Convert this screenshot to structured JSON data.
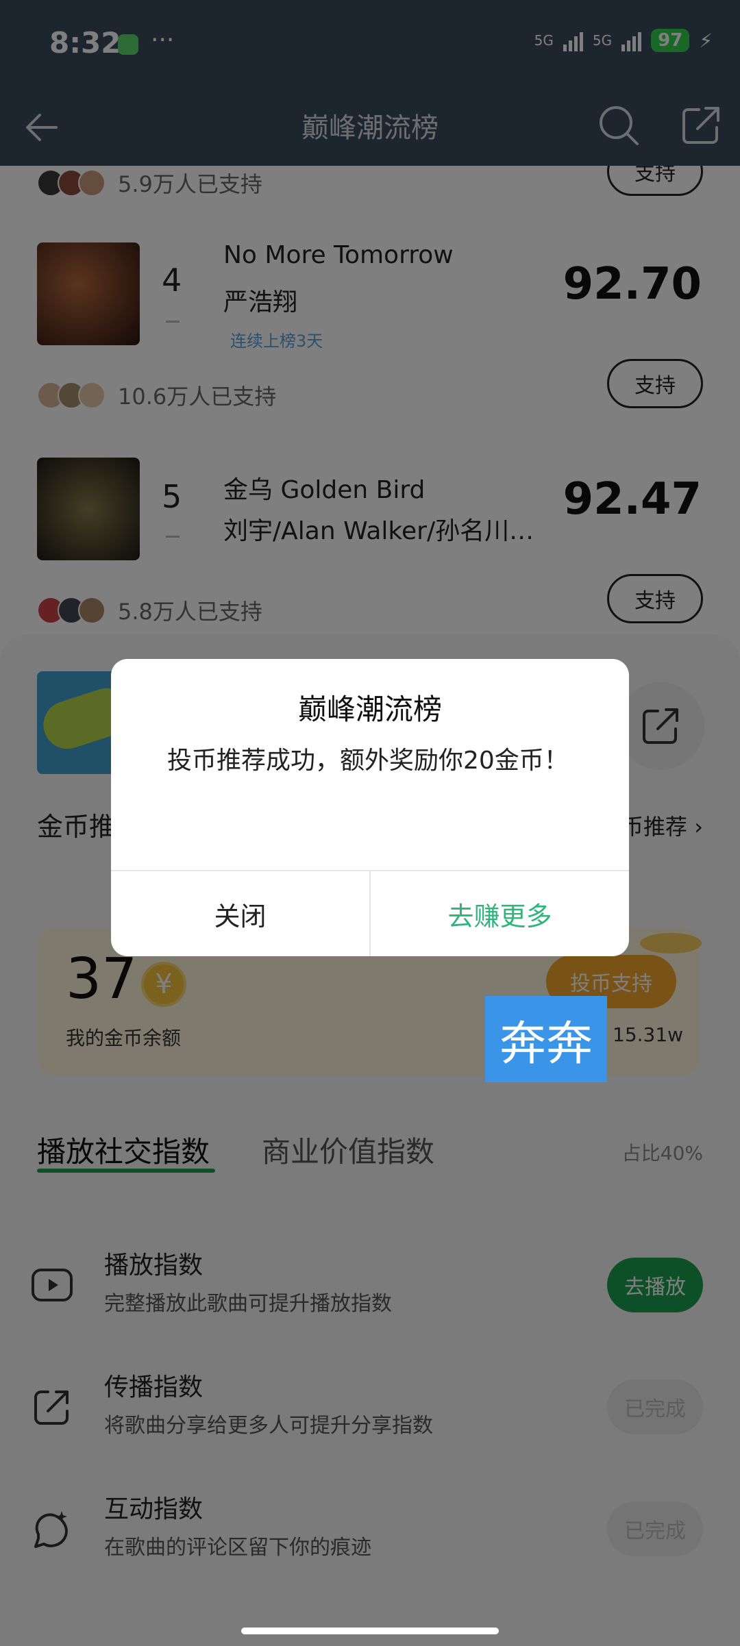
{
  "status": {
    "time": "8:32",
    "dots": "···",
    "net1": "5G",
    "net2": "5G",
    "battery": "97",
    "colors": {
      "bar": "#3a4a5c",
      "battery": "#35d04a"
    }
  },
  "nav": {
    "title": "巅峰潮流榜"
  },
  "list": {
    "top_support": {
      "text": "5.9万人已支持",
      "button": "支持"
    },
    "songs": [
      {
        "rank": "4",
        "title": "No More Tomorrow",
        "artist": "严浩翔",
        "tag": "连续上榜3天",
        "score": "92.70",
        "support_text": "10.6万人已支持",
        "support_button": "支持"
      },
      {
        "rank": "5",
        "title": "金乌 Golden Bird",
        "artist": "刘宇/Alan Walker/孙名川…",
        "score": "92.47",
        "support_text": "5.8万人已支持",
        "support_button": "支持"
      }
    ]
  },
  "sheet": {
    "coin_title": "金币推",
    "coin_link": "币推荐",
    "balance": "37",
    "balance_label": "我的金币余额",
    "coin_symbol": "¥",
    "vote_button": "投币支持",
    "stat": "15.31w",
    "tabs": {
      "active": "播放社交指数",
      "inactive": "商业价值指数",
      "ratio": "占比40%"
    },
    "tasks": [
      {
        "name": "播放指数",
        "desc": "完整播放此歌曲可提升播放指数",
        "button": "去播放",
        "state": "go"
      },
      {
        "name": "传播指数",
        "desc": "将歌曲分享给更多人可提升分享指数",
        "button": "已完成",
        "state": "done"
      },
      {
        "name": "互动指数",
        "desc": "在歌曲的评论区留下你的痕迹",
        "button": "已完成",
        "state": "done"
      }
    ],
    "colors": {
      "accent_green": "#1aa14e",
      "coin_orange": "#f3a42c"
    }
  },
  "dialog": {
    "title": "巅峰潮流榜",
    "message": "投币推荐成功，额外奖励你20金币！",
    "close": "关闭",
    "earn_more": "去赚更多"
  },
  "watermark": {
    "text": "奔奔"
  }
}
